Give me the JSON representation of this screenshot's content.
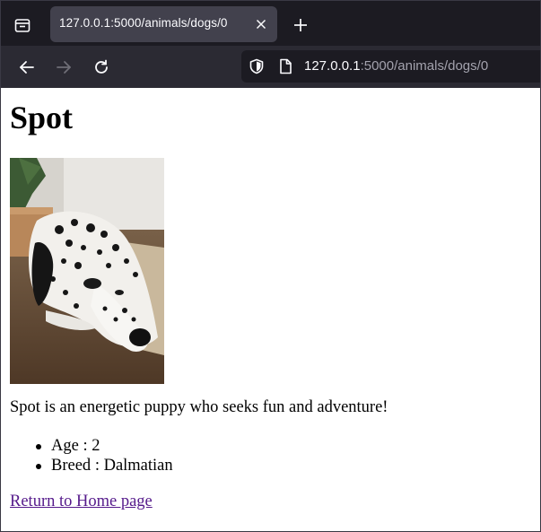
{
  "browser": {
    "tab": {
      "title": "127.0.0.1:5000/animals/dogs/0"
    },
    "url": {
      "host": "127.0.0.1",
      "rest": ":5000/animals/dogs/0"
    }
  },
  "page": {
    "heading": "Spot",
    "photo": {
      "icon": "dalmatian-photo"
    },
    "description": "Spot is an energetic puppy who seeks fun and adventure!",
    "facts": [
      {
        "label": "Age",
        "sep": " : ",
        "value": "2"
      },
      {
        "label": "Breed",
        "sep": " : ",
        "value": "Dalmatian"
      }
    ],
    "home_link": "Return to Home page"
  },
  "colors": {
    "chrome_bg": "#1c1b22",
    "toolbar_bg": "#2b2a33",
    "tab_active": "#42414d",
    "visited_link": "#551a8b"
  }
}
